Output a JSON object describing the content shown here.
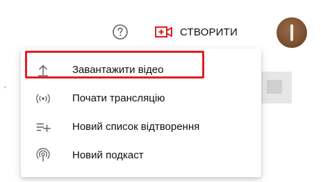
{
  "header": {
    "help_icon": "help-circle-icon",
    "create_icon": "video-plus-icon",
    "create_label": "СТВОРИТИ",
    "create_accent": "#e31b23",
    "avatar_icon": "user-avatar"
  },
  "background": {
    "left_mark": "’"
  },
  "menu": {
    "items": [
      {
        "icon": "upload-icon",
        "label": "Завантажити відео",
        "highlighted": true
      },
      {
        "icon": "live-stream-icon",
        "label": "Почати трансляцію",
        "highlighted": false
      },
      {
        "icon": "playlist-add-icon",
        "label": "Новий список відтворення",
        "highlighted": false
      },
      {
        "icon": "podcast-icon",
        "label": "Новий подкаст",
        "highlighted": false
      }
    ],
    "highlight_color": "#e31b23"
  }
}
